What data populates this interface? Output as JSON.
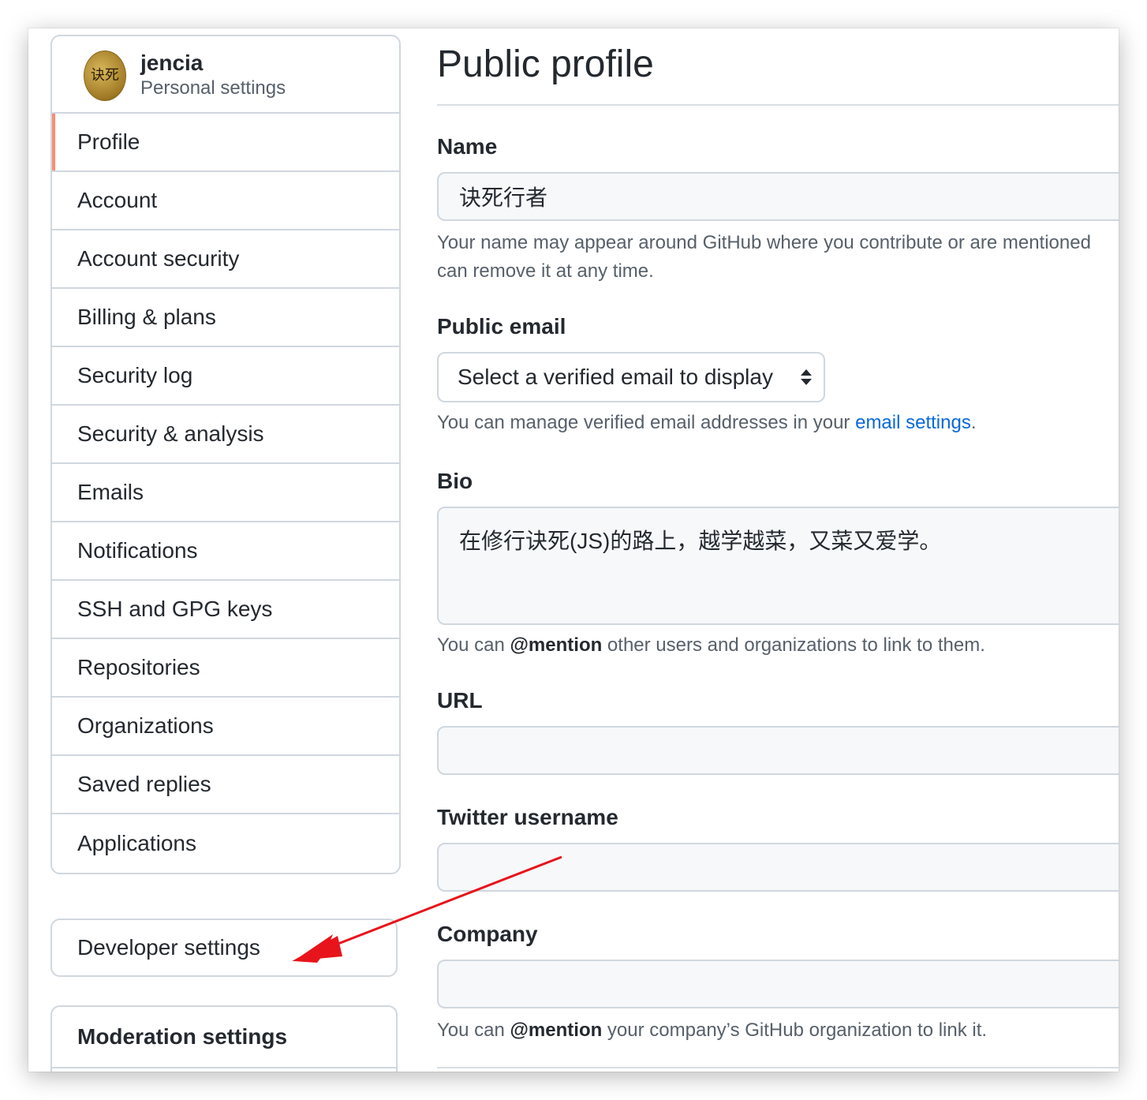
{
  "sidebar": {
    "user": {
      "name": "jencia",
      "subtitle": "Personal settings",
      "avatar_text": "诀死"
    },
    "items": [
      {
        "label": "Profile"
      },
      {
        "label": "Account"
      },
      {
        "label": "Account security"
      },
      {
        "label": "Billing & plans"
      },
      {
        "label": "Security log"
      },
      {
        "label": "Security & analysis"
      },
      {
        "label": "Emails"
      },
      {
        "label": "Notifications"
      },
      {
        "label": "SSH and GPG keys"
      },
      {
        "label": "Repositories"
      },
      {
        "label": "Organizations"
      },
      {
        "label": "Saved replies"
      },
      {
        "label": "Applications"
      }
    ],
    "developer_settings": "Developer settings",
    "moderation_settings": "Moderation settings"
  },
  "main": {
    "title": "Public profile",
    "name": {
      "label": "Name",
      "value": "诀死行者",
      "note_line1": "Your name may appear around GitHub where you contribute or are mentioned",
      "note_line2": "can remove it at any time."
    },
    "public_email": {
      "label": "Public email",
      "selected": "Select a verified email to display",
      "note_prefix": "You can manage verified email addresses in your ",
      "note_link": "email settings",
      "note_suffix": "."
    },
    "bio": {
      "label": "Bio",
      "value": "在修行诀死(JS)的路上，越学越菜，又菜又爱学。",
      "note_prefix": "You can ",
      "note_bold": "@mention",
      "note_suffix": " other users and organizations to link to them."
    },
    "url": {
      "label": "URL",
      "value": ""
    },
    "twitter": {
      "label": "Twitter username",
      "value": ""
    },
    "company": {
      "label": "Company",
      "value": "",
      "note_prefix": "You can ",
      "note_bold": "@mention",
      "note_suffix": " your company’s GitHub organization to link it."
    }
  },
  "colors": {
    "selected_marker": "#fd8c73",
    "link": "#0969da",
    "annotation_arrow": "#e8141b"
  }
}
